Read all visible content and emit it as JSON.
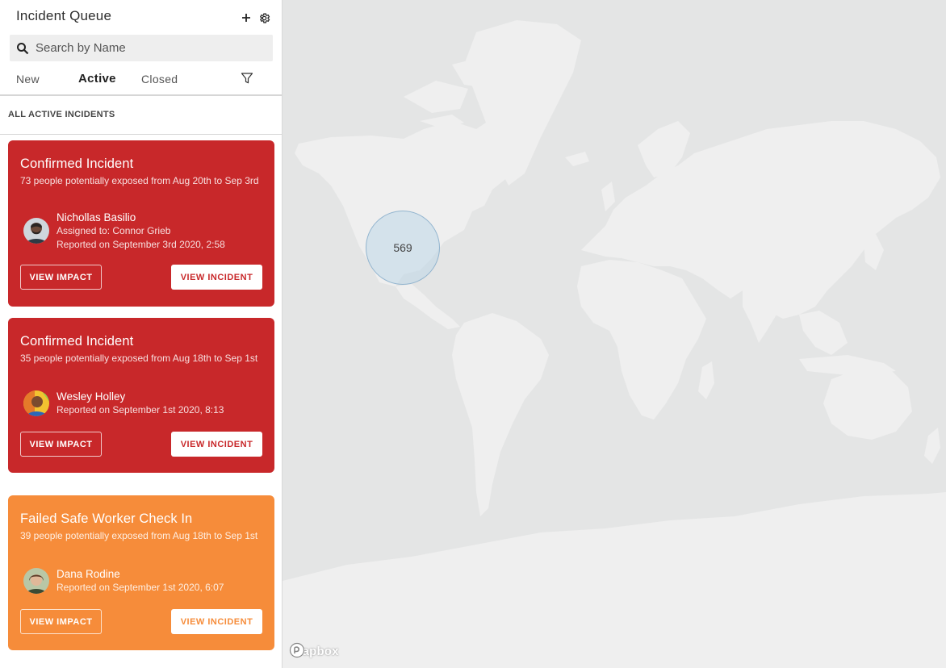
{
  "sidebar": {
    "title": "Incident Queue",
    "add_icon": "plus-icon",
    "settings_icon": "gear-icon",
    "search": {
      "placeholder": "Search by Name",
      "value": ""
    },
    "tabs": [
      {
        "label": "New",
        "active": false
      },
      {
        "label": "Active",
        "active": true
      },
      {
        "label": "Closed",
        "active": false
      }
    ],
    "filter_icon": "filter-icon",
    "section_label": "ALL ACTIVE INCIDENTS",
    "incidents": [
      {
        "title": "Confirmed Incident",
        "description": "73 people potentially exposed from Aug 20th to Sep 3rd",
        "name": "Nichollas Basilio",
        "assigned": "Assigned to: Connor Grieb",
        "reported": "Reported on September 3rd 2020, 2:58",
        "color": "#c8282a",
        "impact_label": "VIEW IMPACT",
        "incident_label": "VIEW INCIDENT"
      },
      {
        "title": "Confirmed Incident",
        "description": "35 people potentially exposed from Aug 18th to Sep 1st",
        "name": "Wesley Holley",
        "reported": "Reported on September 1st 2020, 8:13",
        "color": "#c8282a",
        "impact_label": "VIEW IMPACT",
        "incident_label": "VIEW INCIDENT"
      },
      {
        "title": "Failed Safe Worker Check In",
        "description": "39 people potentially exposed from Aug 18th to Sep 1st",
        "name": "Dana Rodine",
        "reported": "Reported on September 1st 2020, 6:07",
        "color": "#f68c3a",
        "impact_label": "VIEW IMPACT",
        "incident_label": "VIEW INCIDENT"
      }
    ]
  },
  "map": {
    "cluster_count": "569",
    "attribution": "mapbox",
    "land_color": "#efefef",
    "water_color": "#e4e5e5"
  }
}
